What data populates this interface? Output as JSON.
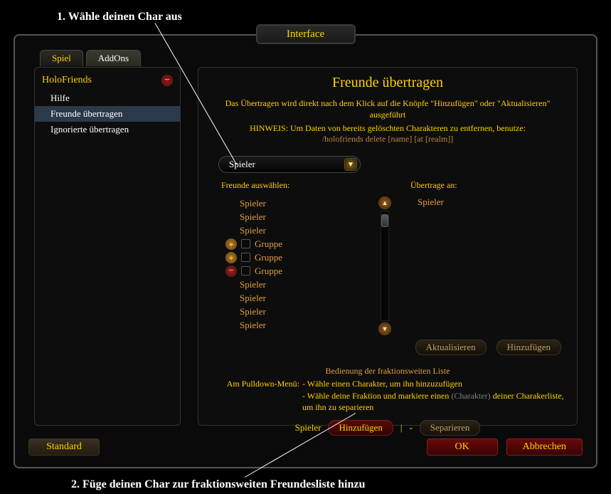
{
  "annotations": {
    "top": "1. Wähle deinen Char aus",
    "bottom": "2. Füge deinen Char zur fraktionsweiten Freundesliste hinzu"
  },
  "window_title": "Interface",
  "tabs": {
    "game": "Spiel",
    "addons": "AddOns"
  },
  "sidebar": {
    "header": "HoloFriends",
    "items": [
      {
        "label": "Hilfe"
      },
      {
        "label": "Freunde übertragen",
        "selected": true
      },
      {
        "label": "Ignorierte übertragen"
      }
    ]
  },
  "content": {
    "title": "Freunde übertragen",
    "desc": "Das Übertragen wird direkt nach dem Klick auf die Knöpfe \"Hinzufügen\" oder \"Aktualisieren\" ausgeführt",
    "hint_label": "HINWEIS: Um Daten von bereits gelöschten Charakteren zu entfernen, benutze:",
    "hint_cmd": "/holofriends delete [name] [at [realm]]",
    "dropdown": "Spieler",
    "col_left_label": "Freunde auswählen:",
    "col_right_label": "Übertrage an:",
    "friend_items": [
      {
        "type": "player",
        "name": "Spieler"
      },
      {
        "type": "player",
        "name": "Spieler"
      },
      {
        "type": "player",
        "name": "Spieler"
      },
      {
        "type": "group",
        "expand": "plus",
        "name": "Gruppe"
      },
      {
        "type": "group",
        "expand": "plus",
        "name": "Gruppe"
      },
      {
        "type": "group",
        "expand": "minus",
        "name": "Gruppe"
      },
      {
        "type": "player",
        "name": "Spieler"
      },
      {
        "type": "player",
        "name": "Spieler"
      },
      {
        "type": "player",
        "name": "Spieler"
      },
      {
        "type": "player",
        "name": "Spieler"
      }
    ],
    "target": "Spieler",
    "btn_refresh": "Aktualisieren",
    "btn_add": "Hinzufügen",
    "instructions": {
      "title": "Bedienung der fraktionsweiten Liste",
      "pulldown_label": "Am Pulldown-Menü:",
      "line1": "- Wähle einen Charakter, um ihn hinzuzufügen",
      "line2a": "- Wähle deine Fraktion und markiere einen ",
      "line2b": "(Charakter)",
      "line2c": " deiner Charakerliste, um ihn zu separieren"
    },
    "bottom": {
      "player": "Spieler",
      "add": "Hinzufügen",
      "separate": "Separieren"
    }
  },
  "footer": {
    "default": "Standard",
    "ok": "OK",
    "cancel": "Abbrechen"
  }
}
